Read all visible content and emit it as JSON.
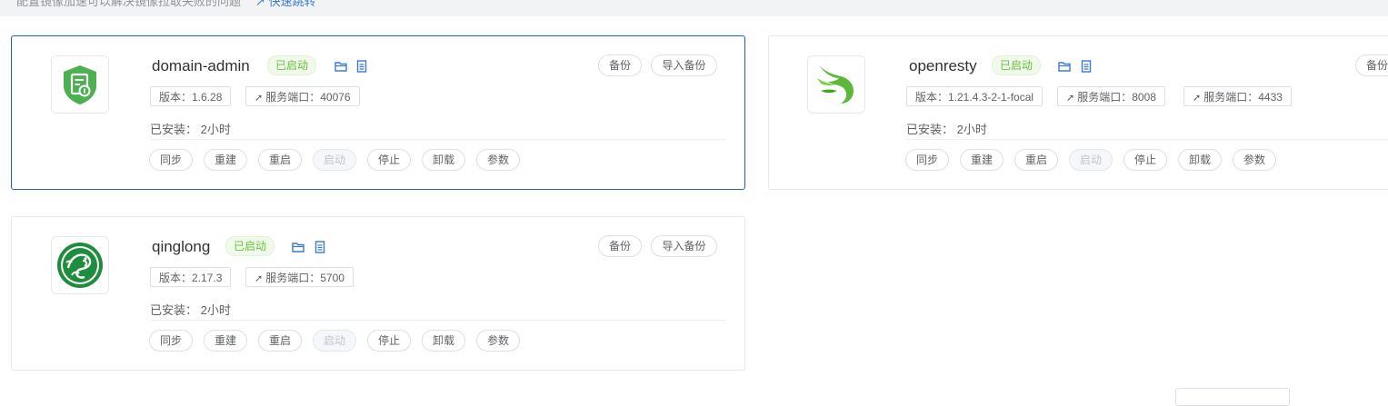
{
  "topbar": {
    "tip": "配置镜像加速可以解决镜像拉取失败的问题",
    "link": "快速跳转"
  },
  "apps": [
    {
      "name": "domain-admin",
      "status": "已启动",
      "version": "版本：1.6.28",
      "ports": [
        "服务端口：40076"
      ],
      "installed": "已安装：  2小时",
      "top_buttons": [
        "备份",
        "导入备份"
      ],
      "actions": [
        "同步",
        "重建",
        "重启",
        "启动",
        "停止",
        "卸载",
        "参数"
      ],
      "icon": "shield-document-icon"
    },
    {
      "name": "openresty",
      "status": "已启动",
      "version": "版本：1.21.4.3-2-1-focal",
      "ports": [
        "服务端口：8008",
        "服务端口：4433"
      ],
      "installed": "已安装：  2小时",
      "top_buttons": [
        "备份"
      ],
      "actions": [
        "同步",
        "重建",
        "重启",
        "启动",
        "停止",
        "卸载",
        "参数"
      ],
      "icon": "green-wing-icon"
    },
    {
      "name": "qinglong",
      "status": "已启动",
      "version": "版本：2.17.3",
      "ports": [
        "服务端口：5700"
      ],
      "installed": "已安装：  2小时",
      "top_buttons": [
        "备份",
        "导入备份"
      ],
      "actions": [
        "同步",
        "重建",
        "重启",
        "启动",
        "停止",
        "卸载",
        "参数"
      ],
      "icon": "dragon-emblem-icon"
    }
  ],
  "colors": {
    "status_green": "#67c23a",
    "icon_blue": "#3a7bd5",
    "active_border": "#1f5fb8",
    "logo_green": "#4caf50",
    "qinglong_green": "#1e8e3e"
  }
}
